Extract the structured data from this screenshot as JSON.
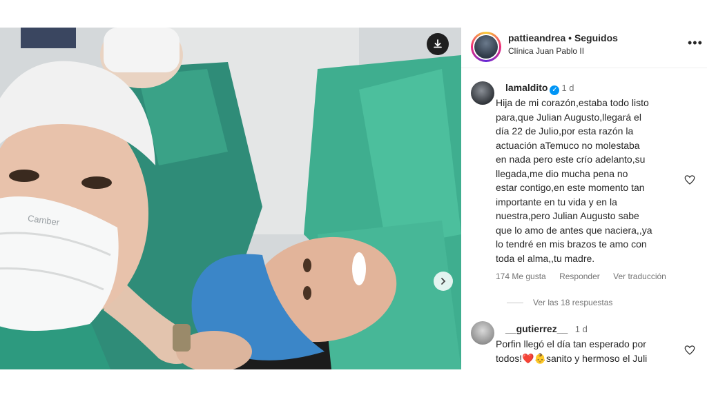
{
  "header": {
    "username": "pattieandrea",
    "separator": "•",
    "follow_status": "Seguidos",
    "location": "Clínica Juan Pablo II",
    "more_icon": "more-horizontal-icon"
  },
  "media": {
    "download_icon": "download-icon",
    "next_icon": "chevron-right-icon",
    "mask_text": "Camber"
  },
  "comments": [
    {
      "username": "lamaldito",
      "verified": true,
      "time": "1 d",
      "text_lines": [
        "Hija de mi corazón,estaba todo listo",
        "para,que Julian Augusto,llegará el",
        "día 22 de Julio,por esta razón la",
        "actuación aTemuco no molestaba",
        "en nada pero este crío adelanto,su",
        "llegada,me dio mucha pena no",
        "estar contigo,en este momento tan",
        "importante en tu vida y en la",
        "nuestra,pero Julian Augusto sabe",
        "que lo amo de antes que naciera,,ya",
        "lo tendré en mis brazos te amo con",
        "toda el alma,,tu madre."
      ],
      "likes": "174 Me gusta",
      "reply": "Responder",
      "translate": "Ver traducción",
      "view_replies": "Ver las 18 respuestas"
    },
    {
      "username": "__gutierrez__",
      "time": "1 d",
      "text_lines": [
        "Porfin llegó el día tan esperado por",
        "todos!❤️👶sanito y hermoso el Juli"
      ]
    }
  ],
  "colors": {
    "verified": "#0095f6",
    "scrubs": "#3fae8f",
    "text_secondary": "#737373"
  }
}
